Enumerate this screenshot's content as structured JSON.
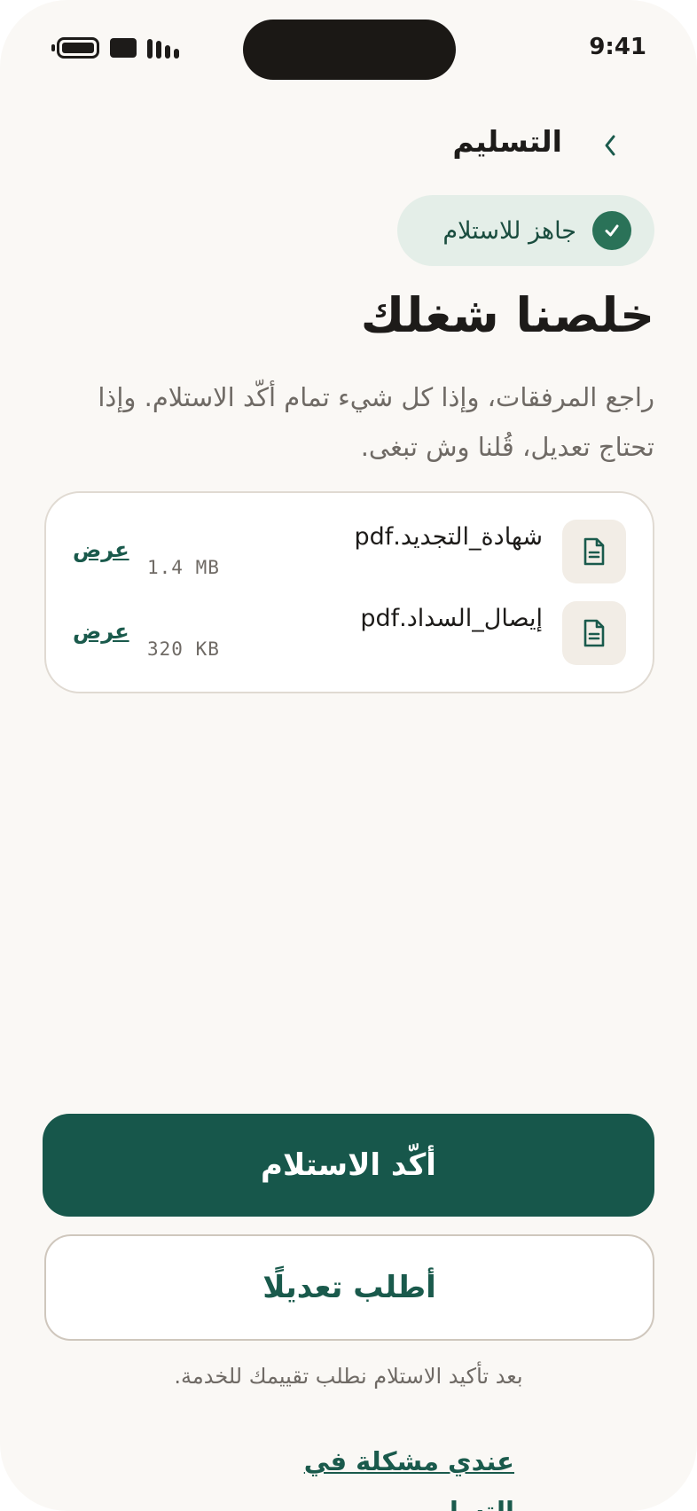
{
  "status_bar": {
    "time": "9:41"
  },
  "header": {
    "title": "التسليم"
  },
  "status_pill": {
    "label": "جاهز للاستلام"
  },
  "main": {
    "headline": "خلصنا شغلك",
    "description": "راجع المرفقات، وإذا كل شيء تمام أكّد الاستلام. وإذا تحتاج تعديل، قُلنا وش تبغى."
  },
  "attachments": [
    {
      "name": "شهادة_التجديد.pdf",
      "size": "1.4 MB",
      "action": "عرض"
    },
    {
      "name": "إيصال_السداد.pdf",
      "size": "320 KB",
      "action": "عرض"
    }
  ],
  "actions": {
    "confirm_label": "أكّد الاستلام",
    "revision_label": "أطلب تعديلًا",
    "rating_note": "بعد تأكيد الاستلام نطلب تقييمك للخدمة.",
    "problem_link": "عندي مشكلة في التسليم"
  },
  "colors": {
    "primary": "#17574b",
    "accent": "#2a7258",
    "pill_bg": "#e4eee8",
    "background": "#faf8f5"
  }
}
